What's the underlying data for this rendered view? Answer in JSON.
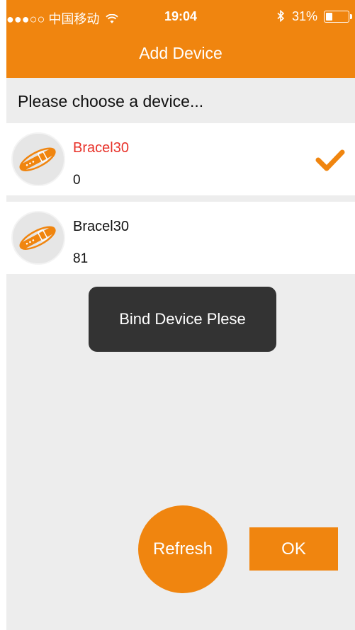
{
  "status_bar": {
    "carrier": "●●●○○ 中国移动",
    "wifi_icon": "wifi-icon",
    "time": "19:04",
    "bluetooth_icon": "bluetooth-icon",
    "battery_percent": "31%",
    "battery_level": 0.31
  },
  "header": {
    "title": "Add Device"
  },
  "subtitle": "Please choose a device...",
  "devices": [
    {
      "name": "Bracel30",
      "rssi": "0",
      "selected": true,
      "icon": "bracelet-icon"
    },
    {
      "name": "Bracel30",
      "rssi": "81",
      "selected": false,
      "icon": "bracelet-icon"
    }
  ],
  "toast": "Bind Device Plese",
  "actions": {
    "refresh_label": "Refresh",
    "ok_label": "OK"
  },
  "colors": {
    "accent": "#f0850f",
    "selected_text": "#e8322a",
    "background": "#ededed",
    "toast_bg": "#333333"
  }
}
